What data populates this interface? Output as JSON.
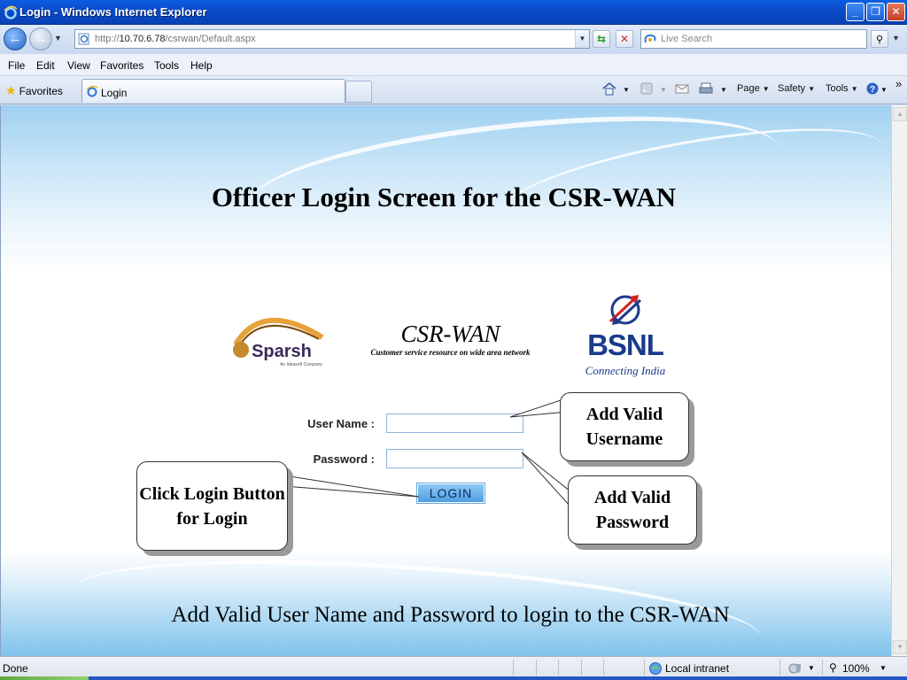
{
  "window": {
    "title": "Login - Windows Internet Explorer",
    "minimize": "_",
    "restore": "❐",
    "close": "✕"
  },
  "address": {
    "url_prefix": "http://",
    "url_host": "10.70.6.78",
    "url_path": "/csrwan/Default.aspx",
    "search_placeholder": "Live Search"
  },
  "menu": {
    "file": "File",
    "edit": "Edit",
    "view": "View",
    "favorites": "Favorites",
    "tools": "Tools",
    "help": "Help"
  },
  "favbar": {
    "favorites": "Favorites",
    "tab_title": "Login",
    "page": "Page",
    "safety": "Safety",
    "tools": "Tools"
  },
  "page": {
    "heading": "Officer Login Screen for the CSR-WAN",
    "csrwan_title": "CSR-WAN",
    "csrwan_subtitle": "Customer service resource on wide area network",
    "sparsh_logo": "Sparsh",
    "sparsh_tag": "An Ideasoft Company",
    "bsnl_logo": "BSNL",
    "bsnl_tagline": "Connecting India",
    "username_label": "User Name :",
    "password_label": "Password :",
    "username_value": "",
    "password_value": "",
    "login_button": "LOGIN",
    "footer_instruction": "Add Valid User Name and Password to login to the CSR-WAN"
  },
  "callouts": {
    "username": "Add Valid Username",
    "password": "Add Valid Password",
    "login": "Click Login Button for Login"
  },
  "status": {
    "text": "Done",
    "zone": "Local intranet",
    "zoom": "100%"
  },
  "colors": {
    "titlebar": "#0a4ccc",
    "bsnl_blue": "#1a3a8c",
    "login_button": "#4e9ee0",
    "sky_blue": "#9fd0f0"
  }
}
